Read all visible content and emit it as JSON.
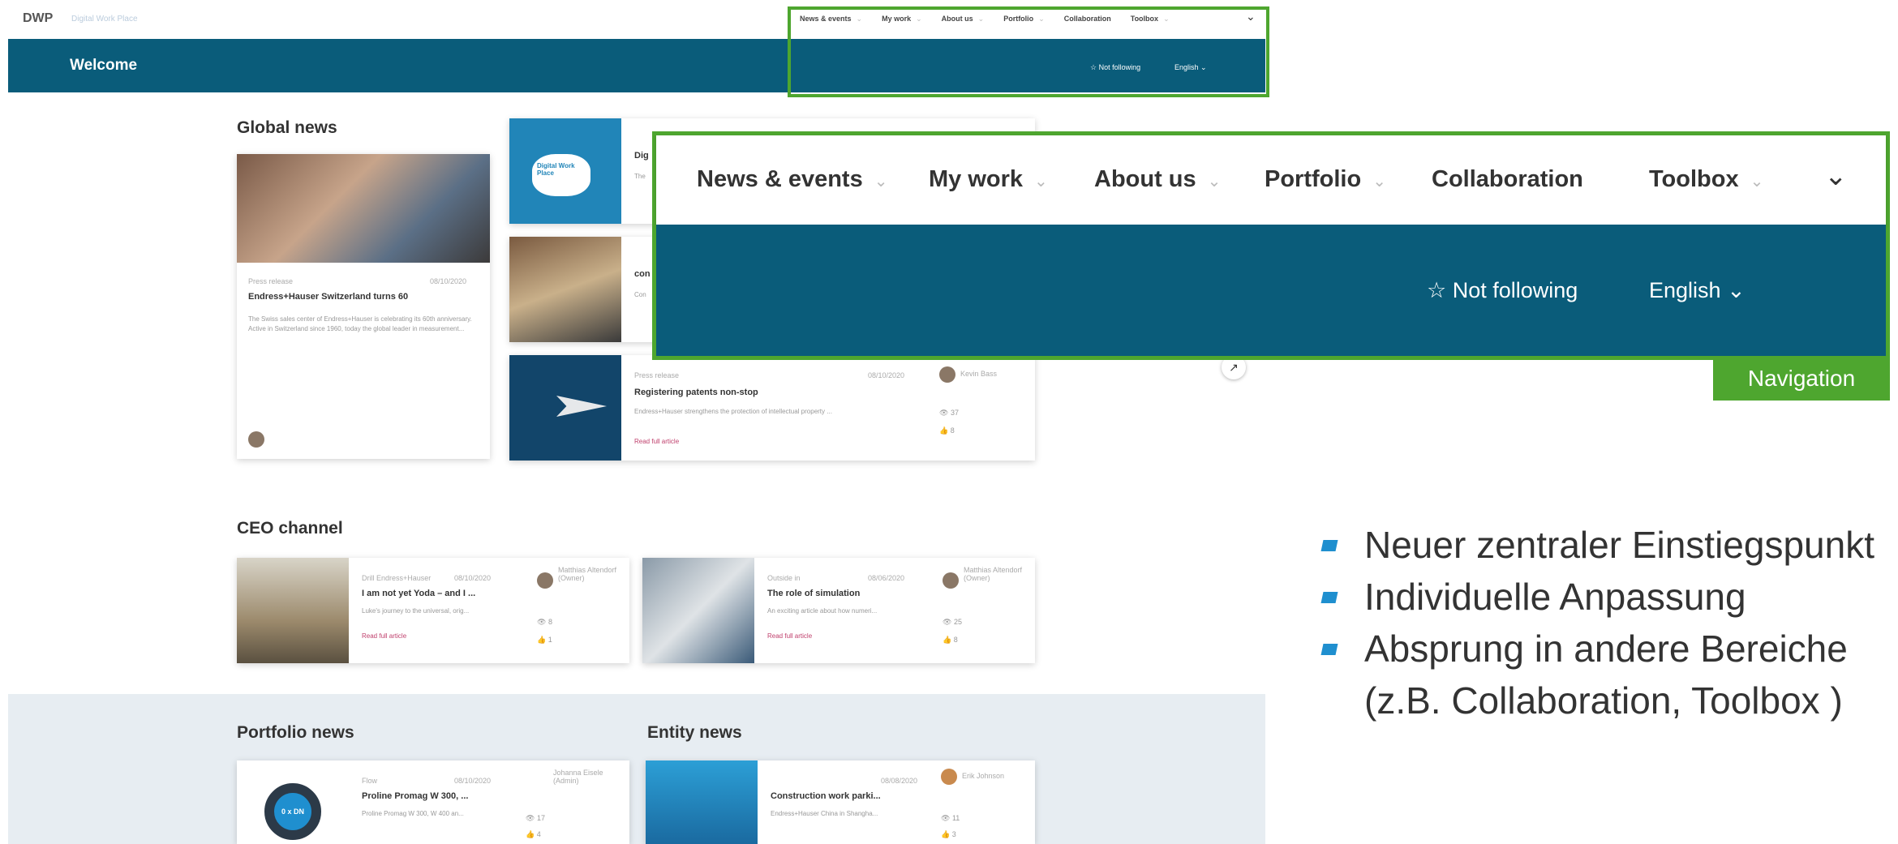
{
  "header": {
    "logo": "DWP",
    "logo_sub": "Digital Work Place",
    "mini_nav": [
      "News & events",
      "My work",
      "About us",
      "Portfolio",
      "Collaboration",
      "Toolbox"
    ],
    "welcome": "Welcome",
    "follow": "Not following",
    "language": "English"
  },
  "global_news": {
    "title": "Global news",
    "feature": {
      "category": "Press release",
      "date": "08/10/2020",
      "headline": "Endress+Hauser Switzerland turns 60",
      "text": "The Swiss sales center of Endress+Hauser is celebrating its 60th anniversary. Active in Switzerland since 1960, today the global leader in measurement..."
    },
    "side": [
      {
        "headline": "Dig",
        "text": "The",
        "badge": "Digital Work Place"
      },
      {
        "headline": "con",
        "text": "Con"
      },
      {
        "category": "Press release",
        "date": "08/10/2020",
        "headline": "Registering patents non-stop",
        "text": "Endress+Hauser strengthens the protection of intellectual property ...",
        "read": "Read full article",
        "author": "Kevin Bass",
        "views": "37",
        "likes": "8"
      }
    ]
  },
  "ceo_channel": {
    "title": "CEO channel",
    "cards": [
      {
        "category": "Drill Endress+Hauser",
        "date": "08/10/2020",
        "headline": "I am not yet Yoda – and I ...",
        "text": "Luke's journey to the universal, orig...",
        "read": "Read full article",
        "author": "Matthias Altendorf (Owner)",
        "views": "8",
        "likes": "1"
      },
      {
        "category": "Outside in",
        "date": "08/06/2020",
        "headline": "The role of simulation",
        "text": "An exciting article about how numeri...",
        "read": "Read full article",
        "author": "Matthias Altendorf (Owner)",
        "views": "25",
        "likes": "8"
      }
    ]
  },
  "portfolio_news": {
    "title": "Portfolio news",
    "card": {
      "category": "Flow",
      "date": "08/10/2020",
      "headline": "Proline Promag W 300, ...",
      "text": "Proline Promag W 300, W 400 an...",
      "author": "Johanna Eisele (Admin)",
      "views": "17",
      "likes": "4",
      "img_label": "0 x DN"
    }
  },
  "entity_news": {
    "title": "Entity news",
    "card": {
      "date": "08/08/2020",
      "headline": "Construction work parki...",
      "text": "Endress+Hauser China in Shangha...",
      "author": "Erik Johnson",
      "views": "11",
      "likes": "3"
    }
  },
  "callout": {
    "nav": [
      "News & events",
      "My work",
      "About us",
      "Portfolio",
      "Collaboration",
      "Toolbox"
    ],
    "follow": "Not following",
    "language": "English",
    "label": "Navigation"
  },
  "bullets": [
    "Neuer zentraler Einstiegspunkt",
    "Individuelle Anpassung",
    "Absprung in andere Bereiche (z.B. Collaboration, Toolbox )"
  ],
  "colors": {
    "brand_blue": "#0a5c7a",
    "highlight_green": "#4ea62f",
    "bullet_blue": "#1f8fcf",
    "link_pink": "#c0406d"
  }
}
